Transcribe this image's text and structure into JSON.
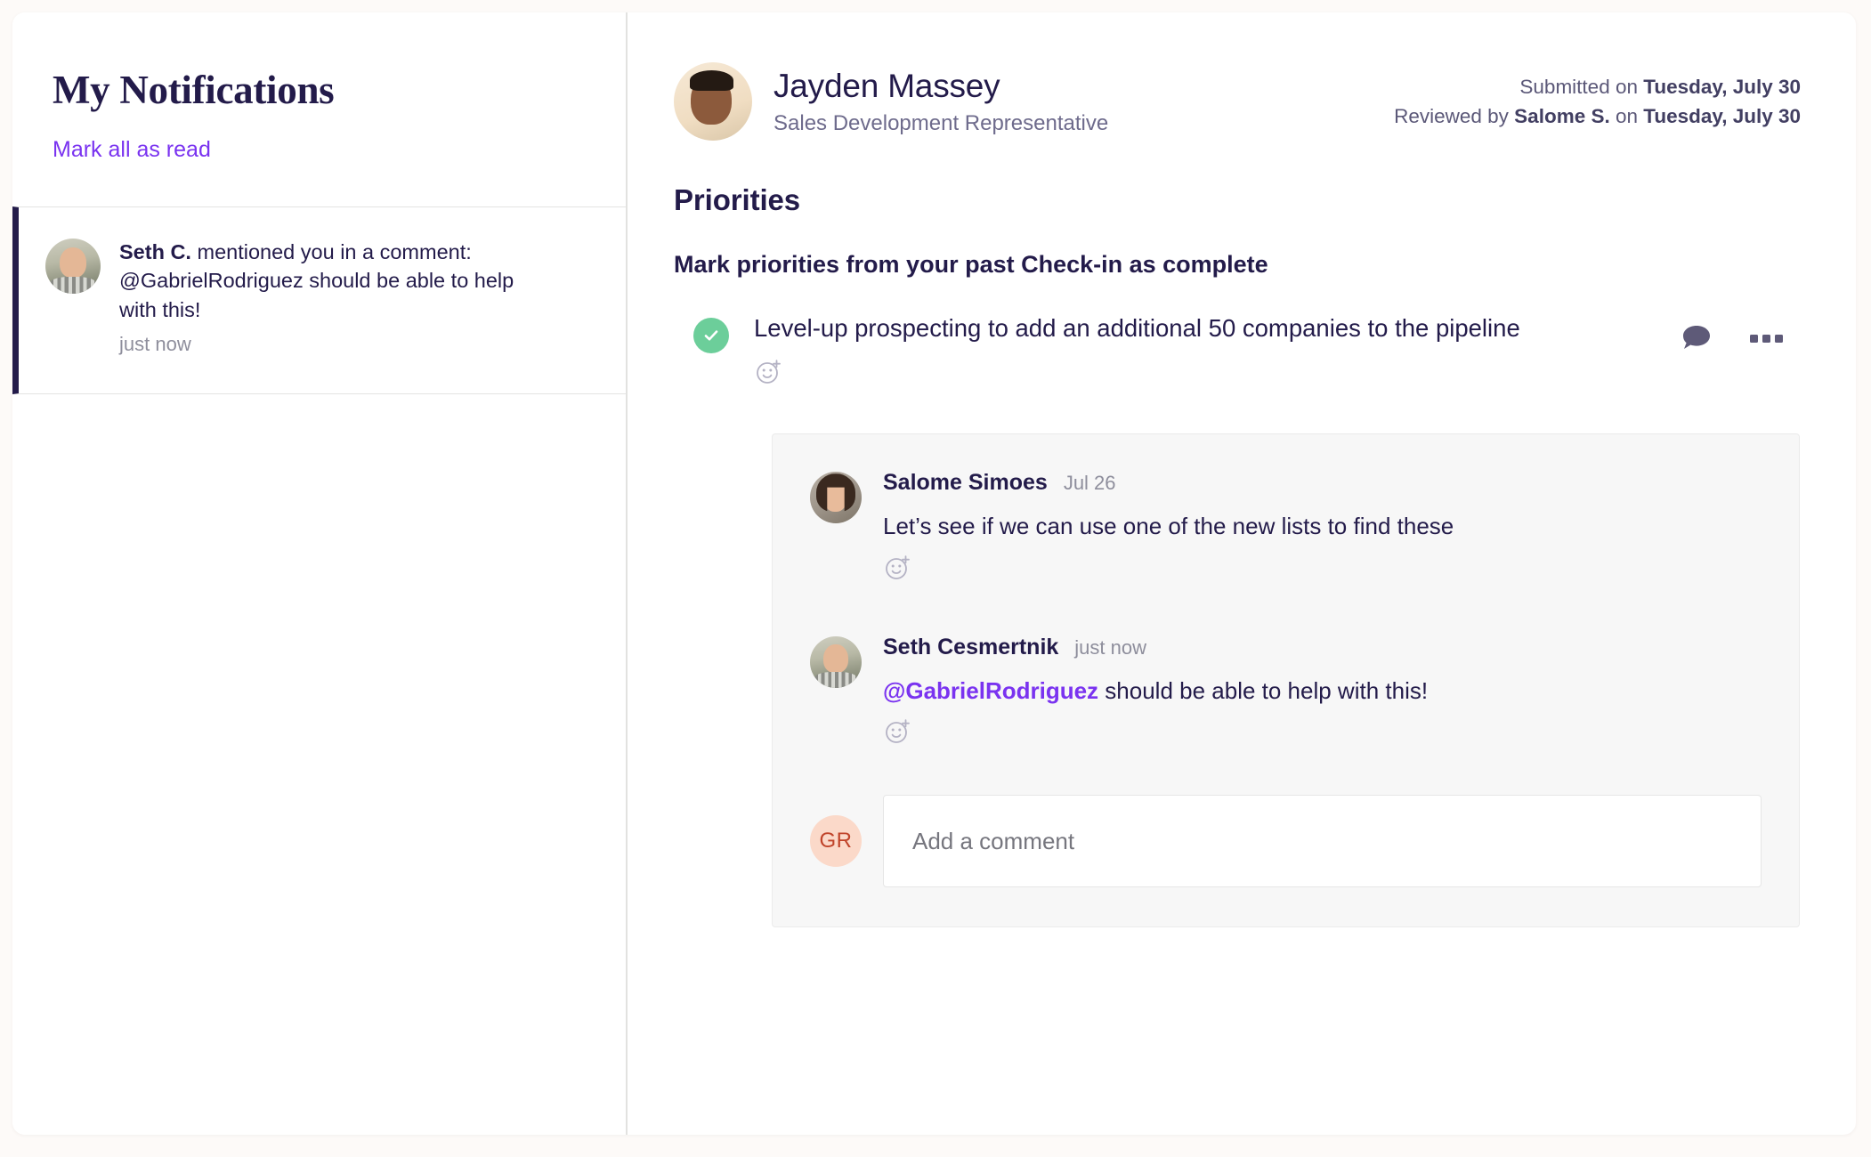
{
  "sidebar": {
    "title": "My Notifications",
    "mark_all_label": "Mark all as read",
    "notifications": [
      {
        "actor": "Seth C.",
        "action": " mentioned you in a comment: @GabrielRodriguez should be able to help with this!",
        "time": "just now",
        "unread": true
      }
    ]
  },
  "main": {
    "person": {
      "name": "Jayden Massey",
      "role": "Sales Development Representative"
    },
    "meta": {
      "submitted_prefix": "Submitted on ",
      "submitted_date": "Tuesday, July 30",
      "reviewed_prefix": "Reviewed by ",
      "reviewer": "Salome S.",
      "reviewed_mid": " on ",
      "reviewed_date": "Tuesday, July 30"
    },
    "section_title": "Priorities",
    "section_subtitle": "Mark priorities from your past Check-in as complete",
    "priority": {
      "text": "Level-up prospecting to add an additional 50 companies to the pipeline",
      "completed": true
    },
    "comments": [
      {
        "author": "Salome Simoes",
        "time": "Jul 26",
        "text": "Let’s see if we can use one of the new lists to find these",
        "mention": "",
        "rest": ""
      },
      {
        "author": "Seth Cesmertnik",
        "time": "just now",
        "text": "",
        "mention": "@GabrielRodriguez",
        "rest": " should be able to help with this!"
      }
    ],
    "add_comment": {
      "avatar_initials": "GR",
      "placeholder": "Add a comment",
      "value": ""
    }
  },
  "colors": {
    "accent_purple": "#7a33f0",
    "ink": "#231b4a",
    "complete_green": "#6cce9a",
    "avatar_peach": "#fbd9c9"
  }
}
